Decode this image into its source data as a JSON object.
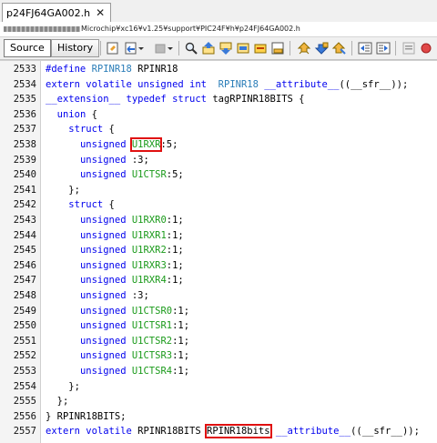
{
  "tab": {
    "title": "p24FJ64GA002.h",
    "close_glyph": "✕"
  },
  "path": {
    "prefix": "",
    "text": "Microchip¥xc16¥v1.25¥support¥PIC24F¥h¥p24FJ64GA002.h"
  },
  "toolbar": {
    "source_label": "Source",
    "history_label": "History"
  },
  "colors": {
    "keyword": "#0000ee",
    "macro": "#2a7db8",
    "field": "#1a9a1a",
    "highlight": "#e01010"
  },
  "code_lines": [
    {
      "num": "2533",
      "segs": [
        {
          "t": "#define ",
          "c": "pp"
        },
        {
          "t": "RPINR18",
          "c": "mac"
        },
        {
          "t": " RPINR18",
          "c": ""
        }
      ]
    },
    {
      "num": "2534",
      "segs": [
        {
          "t": "extern volatile unsigned int",
          "c": "kw"
        },
        {
          "t": "  ",
          "c": ""
        },
        {
          "t": "RPINR18",
          "c": "mac"
        },
        {
          "t": " ",
          "c": ""
        },
        {
          "t": "__attribute__",
          "c": "kw"
        },
        {
          "t": "((__sfr__));",
          "c": ""
        }
      ]
    },
    {
      "num": "2535",
      "segs": [
        {
          "t": "__extension__ typedef struct",
          "c": "kw"
        },
        {
          "t": " tagRPINR18BITS {",
          "c": ""
        }
      ]
    },
    {
      "num": "2536",
      "segs": [
        {
          "t": "  ",
          "c": ""
        },
        {
          "t": "union",
          "c": "kw"
        },
        {
          "t": " {",
          "c": ""
        }
      ]
    },
    {
      "num": "2537",
      "segs": [
        {
          "t": "    ",
          "c": ""
        },
        {
          "t": "struct",
          "c": "kw"
        },
        {
          "t": " {",
          "c": ""
        }
      ]
    },
    {
      "num": "2538",
      "segs": [
        {
          "t": "      ",
          "c": ""
        },
        {
          "t": "unsigned",
          "c": "kw"
        },
        {
          "t": " ",
          "c": ""
        },
        {
          "t": "U1RXR",
          "c": "fld",
          "h": true
        },
        {
          "t": ":5;",
          "c": ""
        }
      ]
    },
    {
      "num": "2539",
      "segs": [
        {
          "t": "      ",
          "c": ""
        },
        {
          "t": "unsigned",
          "c": "kw"
        },
        {
          "t": " :3;",
          "c": ""
        }
      ]
    },
    {
      "num": "2540",
      "segs": [
        {
          "t": "      ",
          "c": ""
        },
        {
          "t": "unsigned",
          "c": "kw"
        },
        {
          "t": " ",
          "c": ""
        },
        {
          "t": "U1CTSR",
          "c": "fld"
        },
        {
          "t": ":5;",
          "c": ""
        }
      ]
    },
    {
      "num": "2541",
      "segs": [
        {
          "t": "    };",
          "c": ""
        }
      ]
    },
    {
      "num": "2542",
      "segs": [
        {
          "t": "    ",
          "c": ""
        },
        {
          "t": "struct",
          "c": "kw"
        },
        {
          "t": " {",
          "c": ""
        }
      ]
    },
    {
      "num": "2543",
      "segs": [
        {
          "t": "      ",
          "c": ""
        },
        {
          "t": "unsigned",
          "c": "kw"
        },
        {
          "t": " ",
          "c": ""
        },
        {
          "t": "U1RXR0",
          "c": "fld"
        },
        {
          "t": ":1;",
          "c": ""
        }
      ]
    },
    {
      "num": "2544",
      "segs": [
        {
          "t": "      ",
          "c": ""
        },
        {
          "t": "unsigned",
          "c": "kw"
        },
        {
          "t": " ",
          "c": ""
        },
        {
          "t": "U1RXR1",
          "c": "fld"
        },
        {
          "t": ":1;",
          "c": ""
        }
      ]
    },
    {
      "num": "2545",
      "segs": [
        {
          "t": "      ",
          "c": ""
        },
        {
          "t": "unsigned",
          "c": "kw"
        },
        {
          "t": " ",
          "c": ""
        },
        {
          "t": "U1RXR2",
          "c": "fld"
        },
        {
          "t": ":1;",
          "c": ""
        }
      ]
    },
    {
      "num": "2546",
      "segs": [
        {
          "t": "      ",
          "c": ""
        },
        {
          "t": "unsigned",
          "c": "kw"
        },
        {
          "t": " ",
          "c": ""
        },
        {
          "t": "U1RXR3",
          "c": "fld"
        },
        {
          "t": ":1;",
          "c": ""
        }
      ]
    },
    {
      "num": "2547",
      "segs": [
        {
          "t": "      ",
          "c": ""
        },
        {
          "t": "unsigned",
          "c": "kw"
        },
        {
          "t": " ",
          "c": ""
        },
        {
          "t": "U1RXR4",
          "c": "fld"
        },
        {
          "t": ":1;",
          "c": ""
        }
      ]
    },
    {
      "num": "2548",
      "segs": [
        {
          "t": "      ",
          "c": ""
        },
        {
          "t": "unsigned",
          "c": "kw"
        },
        {
          "t": " :3;",
          "c": ""
        }
      ]
    },
    {
      "num": "2549",
      "segs": [
        {
          "t": "      ",
          "c": ""
        },
        {
          "t": "unsigned",
          "c": "kw"
        },
        {
          "t": " ",
          "c": ""
        },
        {
          "t": "U1CTSR0",
          "c": "fld"
        },
        {
          "t": ":1;",
          "c": ""
        }
      ]
    },
    {
      "num": "2550",
      "segs": [
        {
          "t": "      ",
          "c": ""
        },
        {
          "t": "unsigned",
          "c": "kw"
        },
        {
          "t": " ",
          "c": ""
        },
        {
          "t": "U1CTSR1",
          "c": "fld"
        },
        {
          "t": ":1;",
          "c": ""
        }
      ]
    },
    {
      "num": "2551",
      "segs": [
        {
          "t": "      ",
          "c": ""
        },
        {
          "t": "unsigned",
          "c": "kw"
        },
        {
          "t": " ",
          "c": ""
        },
        {
          "t": "U1CTSR2",
          "c": "fld"
        },
        {
          "t": ":1;",
          "c": ""
        }
      ]
    },
    {
      "num": "2552",
      "segs": [
        {
          "t": "      ",
          "c": ""
        },
        {
          "t": "unsigned",
          "c": "kw"
        },
        {
          "t": " ",
          "c": ""
        },
        {
          "t": "U1CTSR3",
          "c": "fld"
        },
        {
          "t": ":1;",
          "c": ""
        }
      ]
    },
    {
      "num": "2553",
      "segs": [
        {
          "t": "      ",
          "c": ""
        },
        {
          "t": "unsigned",
          "c": "kw"
        },
        {
          "t": " ",
          "c": ""
        },
        {
          "t": "U1CTSR4",
          "c": "fld"
        },
        {
          "t": ":1;",
          "c": ""
        }
      ]
    },
    {
      "num": "2554",
      "segs": [
        {
          "t": "    };",
          "c": ""
        }
      ]
    },
    {
      "num": "2555",
      "segs": [
        {
          "t": "  };",
          "c": ""
        }
      ]
    },
    {
      "num": "2556",
      "segs": [
        {
          "t": "} RPINR18BITS;",
          "c": ""
        }
      ]
    },
    {
      "num": "2557",
      "segs": [
        {
          "t": "extern volatile",
          "c": "kw"
        },
        {
          "t": " RPINR18BITS ",
          "c": ""
        },
        {
          "t": "RPINR18bits",
          "c": "",
          "h": true
        },
        {
          "t": " ",
          "c": ""
        },
        {
          "t": "__attribute__",
          "c": "kw"
        },
        {
          "t": "((__sfr__));",
          "c": ""
        }
      ]
    }
  ]
}
